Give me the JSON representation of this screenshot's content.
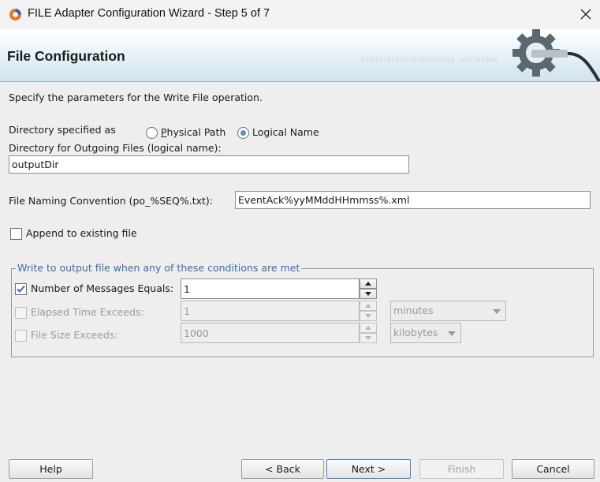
{
  "window": {
    "title": "FILE Adapter Configuration Wizard - Step 5 of 7"
  },
  "banner": {
    "title": "File Configuration",
    "binary": "0101010101010101010101\n010101010"
  },
  "description": "Specify the parameters for the Write File operation.",
  "directory": {
    "specified_label": "Directory specified as",
    "physical_label": "Physical Path",
    "logical_label": "Logical Name",
    "selected": "Logical Name",
    "outgoing_label": "Directory for Outgoing Files (logical name):",
    "outgoing_value": "outputDir"
  },
  "naming": {
    "label": "File Naming Convention (po_%SEQ%.txt):",
    "value": "EventAck%yyMMddHHmmss%.xml"
  },
  "append": {
    "label": "Append to existing file",
    "checked": false
  },
  "conditions": {
    "legend": "Write to output file when any of these conditions are met",
    "messages": {
      "label": "Number of Messages Equals:",
      "value": "1",
      "checked": true
    },
    "elapsed": {
      "label": "Elapsed Time Exceeds:",
      "value": "1",
      "unit": "minutes",
      "checked": false
    },
    "filesize": {
      "label": "File Size Exceeds:",
      "value": "1000",
      "unit": "kilobytes",
      "checked": false
    }
  },
  "buttons": {
    "help": "Help",
    "back": "< Back",
    "next": "Next >",
    "finish": "Finish",
    "cancel": "Cancel"
  }
}
